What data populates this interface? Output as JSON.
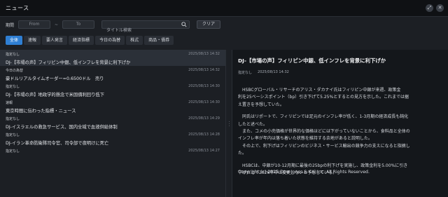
{
  "window": {
    "title": "ニュース",
    "buttons": [
      "⤢",
      "✕"
    ]
  },
  "filter": {
    "period_label": "期間",
    "from_placeholder": "From",
    "tilde": "~",
    "to_placeholder": "To",
    "search_placeholder": "タイトル検索",
    "clear_label": "クリア"
  },
  "tabs": [
    "全体",
    "速報",
    "要人発言",
    "経済指標",
    "今日の為替",
    "株式",
    "商品・債券"
  ],
  "news": [
    {
      "category": "指定なし",
      "time": "2025/08/13 14:32",
      "headline": "DJ-【市場の声】フィリピン中銀、低インフレを背景に利下げか"
    },
    {
      "category": "今日の為替",
      "time": "2025/08/13 14:32",
      "headline": "豪ドルリアルタイムオーダー=0.6500ドル　売り"
    },
    {
      "category": "指定なし",
      "time": "2025/08/13 14:30",
      "headline": "DJ-【市場の声】地政学的懸念で米国債利回り低下"
    },
    {
      "category": "速報",
      "time": "2025/08/13 14:30",
      "headline": "東京時間に伝わった指標・ニュース"
    },
    {
      "category": "指定なし",
      "time": "2025/08/13 14:29",
      "headline": "DJ-イスラエルの救急サービス、国内全域で血液供給体制"
    },
    {
      "category": "指定なし",
      "time": "2025/08/13 14:28",
      "headline": "DJ-イラン革命防衛隊司令官、司令部で夜明けに死亡"
    },
    {
      "category": "指定なし",
      "time": "2025/08/13 14:27",
      "headline": ""
    }
  ],
  "detail": {
    "title": "DJ-【市場の声】フィリピン中銀、低インフレを背景に利下げか",
    "category": "指定なし",
    "time": "2025/08/13 14:32",
    "paragraphs": [
      "　HSBCグローバル・リサーチのアリス・ダカナイ氏はフィリピン中銀が来週、政策金",
      "利を25ベーシスポイント（bp）引き下げて5.25%とするとの見方を示した。これまでは据",
      "え置きを予想していた。",
      "　同氏はリポートで、フィリピンでは足元のインフレ率が低く、1-3月期の経済成長も鈍化",
      "したと述べた。",
      "　また、コメの小売価格が世界的な価格ほどには下がっていないことから、食料品と全体の",
      "インフレ率が年内は落ち着いた状態を維持する余地があると説明した。",
      "　その上で、利下げはフィリピンのビジネス・サービス輸出の競争力の支えになると指摘し",
      "た。",
      "　HSBCは、中銀が10-12月期に最後の25bpの利下げを実施し、政策金利を5.00%に引き",
      "下げた上で2026年中は変更しないと予想している。"
    ],
    "copyright": "Copyright (c) 2025 Dow Jones & Co. Inc. All Rights Reserved."
  }
}
